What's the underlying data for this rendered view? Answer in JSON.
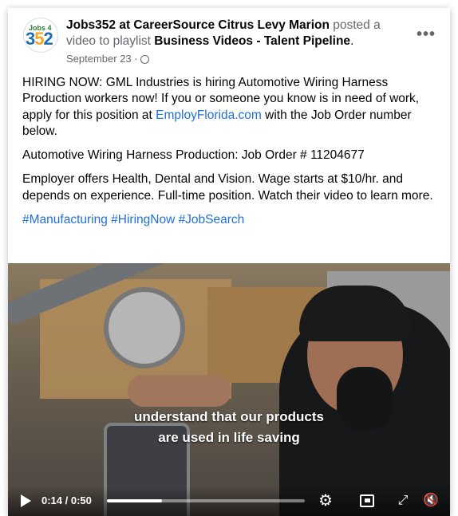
{
  "post": {
    "page_name": "Jobs352 at CareerSource Citrus Levy Marion",
    "action_text": " posted a video to playlist ",
    "playlist": "Business Videos - Talent Pipeline",
    "after_playlist": ".",
    "date": "September 23 ·",
    "more_label": "•••",
    "avatar_top": "Jobs 4",
    "avatar_num_a": "3",
    "avatar_num_b": "5",
    "avatar_num_c": "2"
  },
  "body": {
    "para1_a": "HIRING NOW: GML Industries is hiring Automotive Wiring Harness Production workers now! If you or someone you know is in need of work, apply for this position at ",
    "para1_link": "EmployFlorida.com",
    "para1_b": " with the Job Order number below.",
    "para2": "Automotive Wiring Harness Production: Job Order # 11204677",
    "para3": "Employer offers Health, Dental and Vision. Wage starts at $10/hr. and depends on experience. Full-time position. Watch their video to learn more.",
    "hashtags": "#Manufacturing #HiringNow #JobSearch"
  },
  "video": {
    "caption_line1": "understand that our products",
    "caption_line2": "are used in life saving",
    "time": "0:14 / 0:50",
    "progress": 0.28,
    "controls": [
      "play-icon",
      "settings-icon",
      "pip-icon",
      "fullscreen-icon",
      "mute-icon"
    ]
  }
}
